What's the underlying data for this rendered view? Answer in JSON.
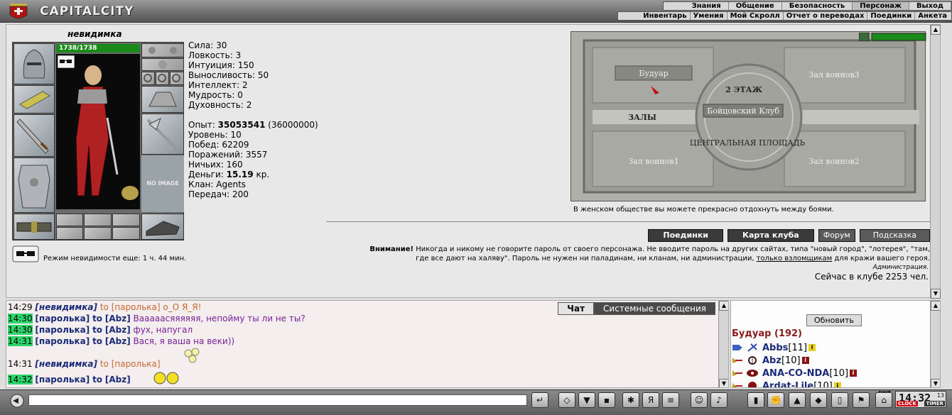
{
  "app": {
    "logo_text": "CAPITALCITY"
  },
  "nav_primary": [
    "Знания",
    "Общение",
    "Безопасность",
    "Персонаж",
    "Выход"
  ],
  "nav_primary_active": "Персонаж",
  "nav_secondary": [
    "Инвентарь",
    "Умения",
    "Мой Скролл",
    "Отчет о переводах",
    "Поединки",
    "Анкета"
  ],
  "character": {
    "name": "невидимка",
    "hp": "1738/1738",
    "no_image": "NO IMAGE",
    "stats": [
      {
        "label": "Сила:",
        "value": "30"
      },
      {
        "label": "Ловкость:",
        "value": "3"
      },
      {
        "label": "Интуиция:",
        "value": "150"
      },
      {
        "label": "Выносливость:",
        "value": "50"
      },
      {
        "label": "Интеллект:",
        "value": "2"
      },
      {
        "label": "Мудрость:",
        "value": "0"
      },
      {
        "label": "Духовность:",
        "value": "2"
      }
    ],
    "experience_label": "Опыт:",
    "experience": "35053541",
    "experience_next": "(36000000)",
    "level_label": "Уровень:",
    "level": "10",
    "wins_label": "Побед:",
    "wins": "62209",
    "losses_label": "Поражений:",
    "losses": "3557",
    "draws_label": "Ничьих:",
    "draws": "160",
    "money_label": "Деньги:",
    "money": "15.19",
    "money_unit": "кр.",
    "clan_label": "Клан:",
    "clan": "Agents",
    "transfers_label": "Передач:",
    "transfers": "200",
    "invisibility_text": "Режим невидимости еще: 1 ч. 44 мин."
  },
  "map": {
    "rooms": {
      "boudoir": "Будуар",
      "hall3": "Зал воинов3",
      "floor": "2 ЭТАЖ",
      "club": "Бойцовский Клуб",
      "halls": "ЗАЛЫ",
      "square": "ЦЕНТРАЛЬНАЯ ПЛОЩАДЬ",
      "hall1": "Зал воинов1",
      "hall2": "Зал воинов2"
    },
    "caption": "В женском обществе вы можете прекрасно отдохнуть между боями."
  },
  "buttons": {
    "battles": "Поединки",
    "club_map": "Карта клуба",
    "forum": "Форум",
    "hint": "Подсказка"
  },
  "warning": {
    "title": "Внимание!",
    "text1": " Никогда и никому не говорите пароль от своего персонажа. Не вводите пароль на других сайтах, типа \"новый город\", \"лотерея\", \"там,",
    "text2": "где все дают на халяву\". Пароль не нужен ни паладинам, ни кланам, ни администрации, ",
    "link": "только взломщикам",
    "text3": " для кражи вашего героя.",
    "signature": "Администрация."
  },
  "online_text": "Сейчас в клубе 2253 чел.",
  "chat": {
    "tabs": [
      "Чат",
      "Системные сообщения"
    ],
    "messages": [
      {
        "time": "14:29",
        "hl": false,
        "from": "невидимка",
        "italic": true,
        "to_word": "to",
        "to": "[паролька]",
        "text": "о_О Я_Я!",
        "private": false
      },
      {
        "time": "14:30",
        "hl": true,
        "from": "паролька",
        "italic": false,
        "to_word": "to",
        "to": "[Abz]",
        "text": "Вааааасяяяяяя, непойму ты ли не ты?",
        "private": true
      },
      {
        "time": "14:30",
        "hl": true,
        "from": "паролька",
        "italic": false,
        "to_word": "to",
        "to": "[Abz]",
        "text": "фух, напугал",
        "private": true
      },
      {
        "time": "14:31",
        "hl": true,
        "from": "паролька",
        "italic": false,
        "to_word": "to",
        "to": "[Abz]",
        "text": "Вася, я ваша на веки))",
        "private": true
      },
      {
        "time": "14:31",
        "hl": false,
        "from": "невидимка",
        "italic": true,
        "to_word": "to",
        "to": "[паролька]",
        "text": "",
        "private": false
      },
      {
        "time": "14:32",
        "hl": true,
        "from": "паролька",
        "italic": false,
        "to_word": "to",
        "to": "[Abz]",
        "text": "",
        "private": true
      }
    ]
  },
  "users": {
    "refresh": "Обновить",
    "room": "Будуар (192)",
    "list": [
      {
        "name": "Abbs",
        "level": "[11]",
        "info": "i",
        "info_color": "y"
      },
      {
        "name": "Abz",
        "level": "[10]",
        "info": "i",
        "info_color": "r"
      },
      {
        "name": "ANA-CO-NDA",
        "level": "[10]",
        "info": "i",
        "info_color": "r"
      },
      {
        "name": "Ardat-Lile",
        "level": "[10]",
        "info": "i",
        "info_color": "y"
      }
    ]
  },
  "bottom": {
    "exit_label": "EXIT",
    "clock_time": "14:32",
    "clock_seconds": "13",
    "clock_label": "CLOCK",
    "timer_label": "TIMER"
  },
  "colors": {
    "hp_green": "#1a8a1a",
    "time_highlight": "#2ed66a",
    "nick_blue": "#1a2b7a",
    "private_purple": "#7a1f99",
    "to_orange": "#c76a2c",
    "room_red": "#8b1b1b"
  }
}
